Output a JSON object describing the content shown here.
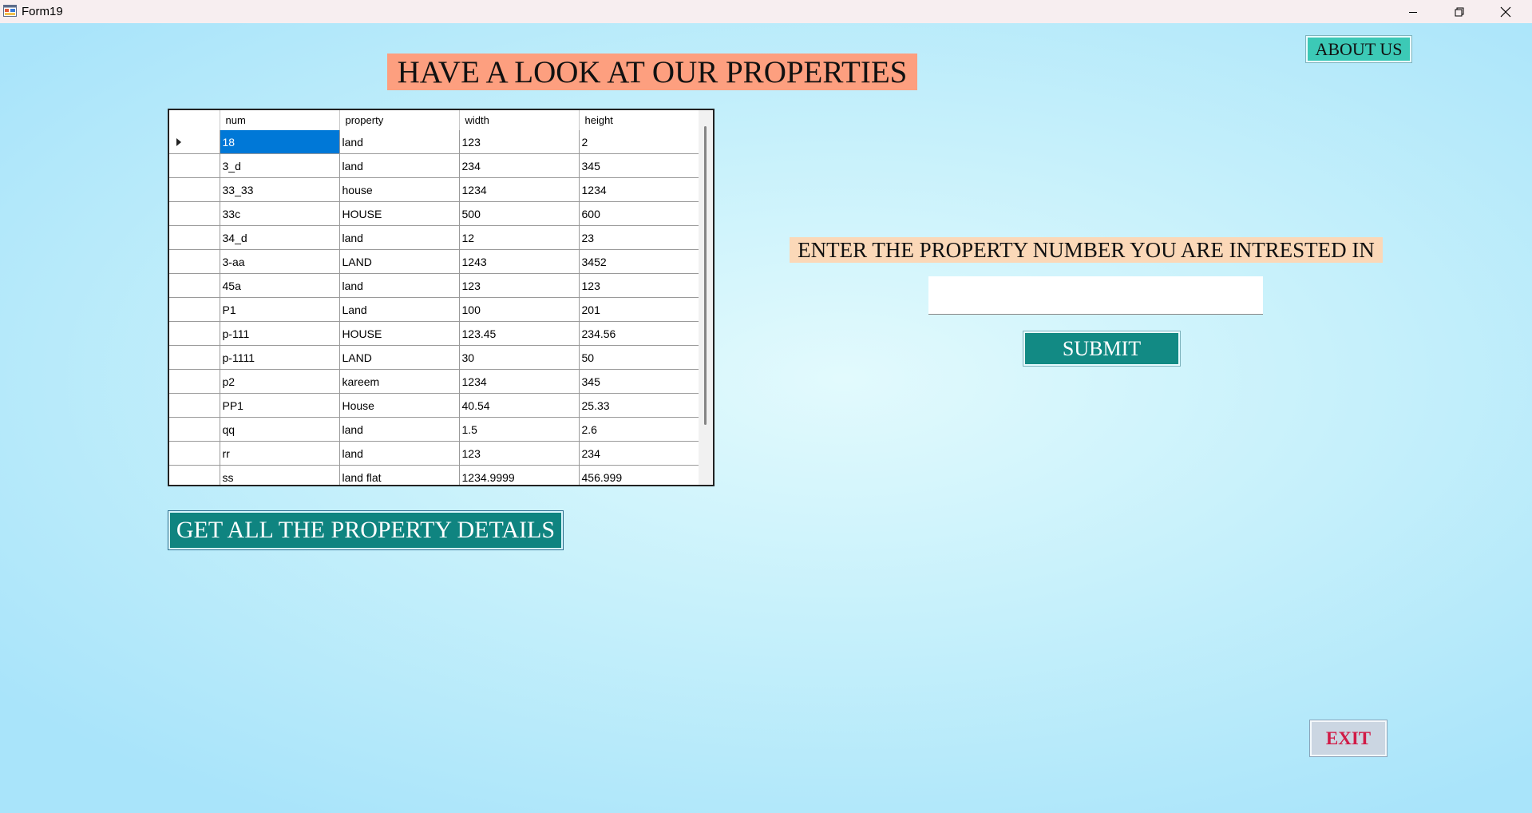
{
  "window": {
    "title": "Form19",
    "icon": "form-app-icon",
    "controls": [
      "minimize-icon",
      "restore-icon",
      "close-icon"
    ]
  },
  "header": {
    "title": "HAVE A LOOK AT OUR PROPERTIES",
    "title_bg": "#fd9f7f"
  },
  "about_button": {
    "label": "ABOUT US",
    "bg": "#3cc9b6"
  },
  "grid": {
    "columns": [
      "num",
      "property",
      "width",
      "height"
    ],
    "rows": [
      [
        "18",
        "land",
        "123",
        "2"
      ],
      [
        "3_d",
        "land",
        "234",
        "345"
      ],
      [
        "33_33",
        "house",
        "1234",
        "1234"
      ],
      [
        "33c",
        "HOUSE",
        "500",
        "600"
      ],
      [
        "34_d",
        "land",
        "12",
        "23"
      ],
      [
        "3-aa",
        "LAND",
        "1243",
        "3452"
      ],
      [
        "45a",
        "land",
        "123",
        "123"
      ],
      [
        "P1",
        "Land",
        "100",
        "201"
      ],
      [
        "p-111",
        "HOUSE",
        "123.45",
        "234.56"
      ],
      [
        "p-1111",
        "LAND",
        "30",
        "50"
      ],
      [
        "p2",
        "kareem",
        "1234",
        "345"
      ],
      [
        "PP1",
        "House",
        "40.54",
        "25.33"
      ],
      [
        "qq",
        "land",
        "1.5",
        "2.6"
      ],
      [
        "rr",
        "land",
        "123",
        "234"
      ],
      [
        "ss",
        "land flat",
        "1234.9999",
        "456.999"
      ]
    ],
    "selected_cell_color": "#0078d7"
  },
  "details_button": {
    "label": "GET ALL THE PROPERTY DETAILS",
    "bg": "#0f8480"
  },
  "prompt": {
    "label": "ENTER THE PROPERTY NUMBER YOU ARE INTRESTED IN",
    "bg": "#fbd8b8"
  },
  "property_input": {
    "value": ""
  },
  "submit_button": {
    "label": "SUBMIT",
    "bg": "#128a84"
  },
  "exit_button": {
    "label": "EXIT",
    "color": "#d11a46"
  }
}
